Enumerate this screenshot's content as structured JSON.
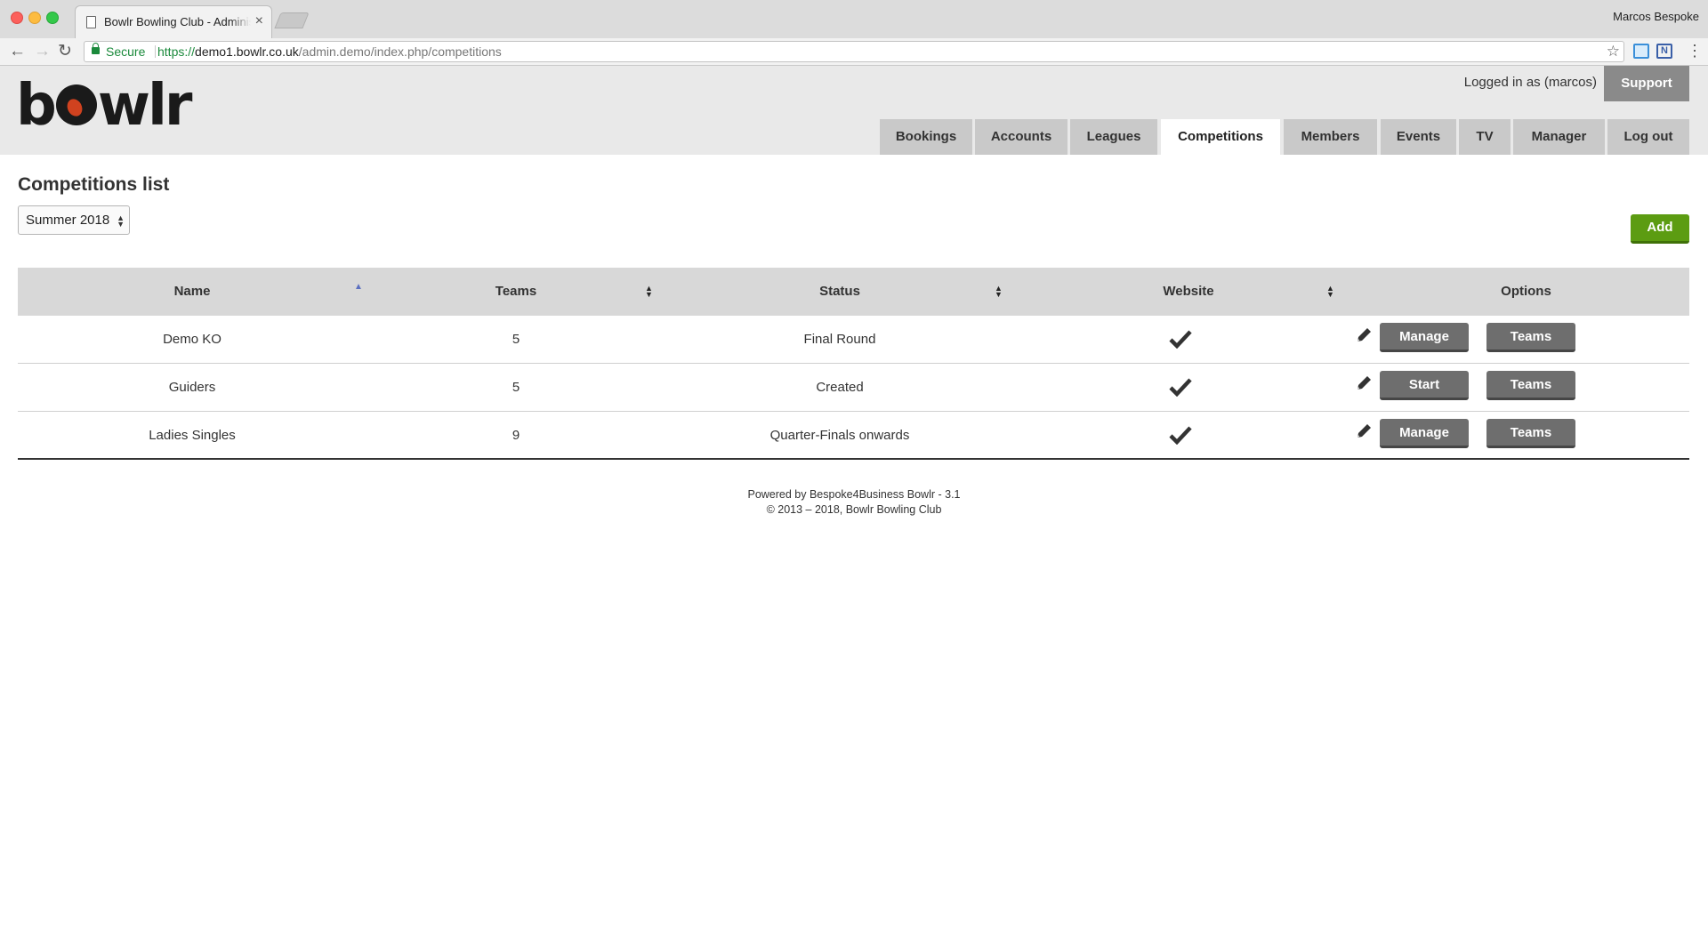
{
  "browser": {
    "tab_title": "Bowlr Bowling Club - Administration",
    "tab_close": "×",
    "os_user": "Marcos Bespoke",
    "secure_label": "Secure",
    "url_scheme": "https://",
    "url_host": "demo1.bowlr.co.uk",
    "url_path": "/admin.demo/index.php/competitions",
    "ext2_label": "N"
  },
  "header": {
    "logo_before": "b",
    "logo_after": "wlr",
    "logged_in": "Logged in as (marcos)",
    "support_label": "Support",
    "nav": [
      {
        "label": "Bookings"
      },
      {
        "label": "Accounts"
      },
      {
        "label": "Leagues"
      },
      {
        "label": "Competitions",
        "active": true
      },
      {
        "label": "Members"
      },
      {
        "label": "Events"
      },
      {
        "label": "TV"
      },
      {
        "label": "Manager"
      },
      {
        "label": "Log out"
      }
    ]
  },
  "page": {
    "title": "Competitions list",
    "season": "Summer 2018",
    "add_label": "Add"
  },
  "table": {
    "columns": [
      "Name",
      "Teams",
      "Status",
      "Website",
      "Options"
    ],
    "rows": [
      {
        "name": "Demo KO",
        "teams": "5",
        "status": "Final Round",
        "website": true,
        "action": "Manage",
        "teams_btn": "Teams"
      },
      {
        "name": "Guiders",
        "teams": "5",
        "status": "Created",
        "website": true,
        "action": "Start",
        "teams_btn": "Teams"
      },
      {
        "name": "Ladies Singles",
        "teams": "9",
        "status": "Quarter-Finals onwards",
        "website": true,
        "action": "Manage",
        "teams_btn": "Teams"
      }
    ]
  },
  "footer": {
    "powered": "Powered by Bespoke4Business Bowlr - 3.1",
    "copyright": "© 2013 – 2018, Bowlr Bowling Club"
  },
  "colors": {
    "add_button": "#5c9c12",
    "action_button": "#6e6e6e",
    "header_bg": "#e9e9e9",
    "nav_tab": "#c9c9c9",
    "accent_red": "#d0421f"
  }
}
